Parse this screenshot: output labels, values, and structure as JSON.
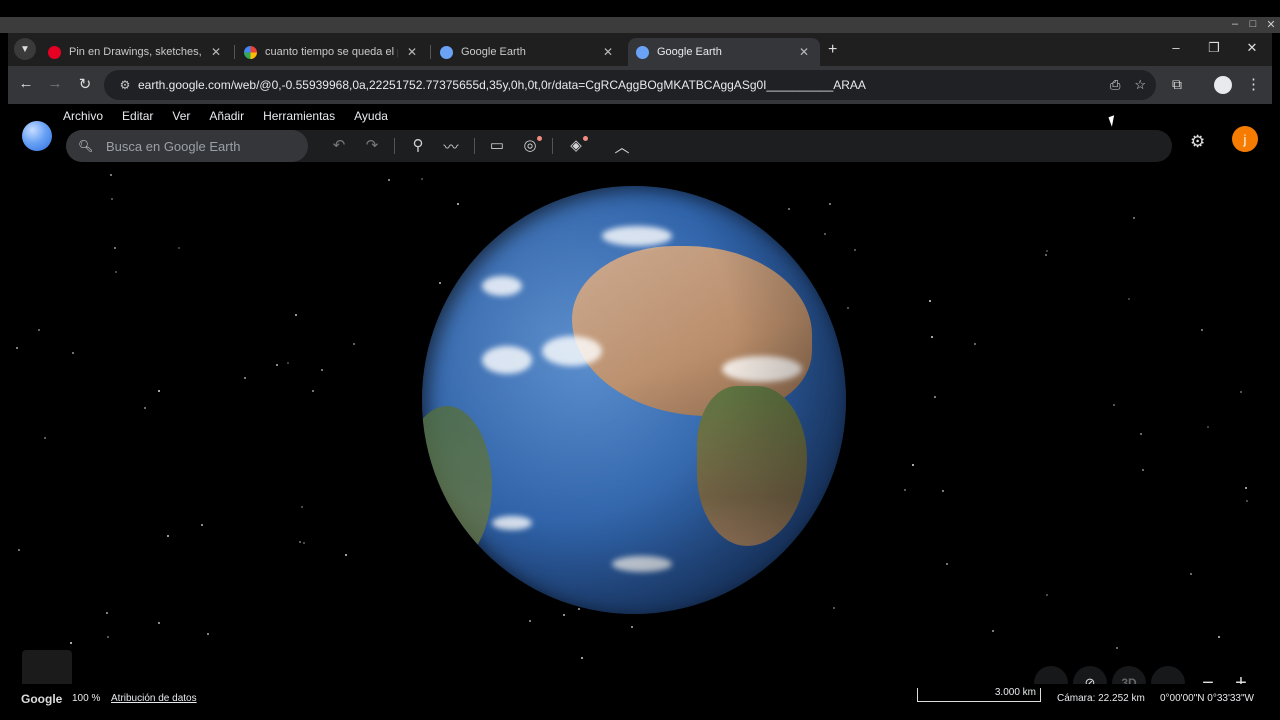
{
  "tabs": [
    {
      "title": "Pin en Drawings, sketches, illus",
      "favicon_color": "#e60023",
      "active": false
    },
    {
      "title": "cuanto tiempo se queda el pol",
      "favicon_color": "#4285f4",
      "active": false
    },
    {
      "title": "Google Earth",
      "favicon_color": "#6aa3f5",
      "active": false
    },
    {
      "title": "Google Earth",
      "favicon_color": "#6aa3f5",
      "active": true
    }
  ],
  "address_bar": {
    "url": "earth.google.com/web/@0,-0.55939968,0a,22251752.77375655d,35y,0h,0t,0r/data=CgRCAggBOgMKATBCAggASg0I__________ARAA"
  },
  "menu": [
    "Archivo",
    "Editar",
    "Ver",
    "Añadir",
    "Herramientas",
    "Ayuda"
  ],
  "search": {
    "placeholder": "Busca en Google Earth",
    "value": ""
  },
  "user": {
    "avatar_letter": "j",
    "avatar_color": "#f57c00"
  },
  "controls": {
    "view_3d_label": "3D"
  },
  "footer": {
    "logo": "Google",
    "zoom": "100 %",
    "attribution": "Atribución de datos",
    "scale": "3.000 km",
    "camera": "Cámara: 22.252 km",
    "coordinates": "0°00'00\"N 0°33'33\"W"
  },
  "icons": {
    "search": "search-icon",
    "undo": "undo-icon",
    "redo": "redo-icon",
    "placemark": "placemark-icon",
    "path": "path-icon",
    "ruler": "ruler-icon",
    "street_view": "street-view-icon",
    "layers": "layers-icon",
    "collapse": "chevron-up-icon",
    "settings": "gear-icon"
  }
}
